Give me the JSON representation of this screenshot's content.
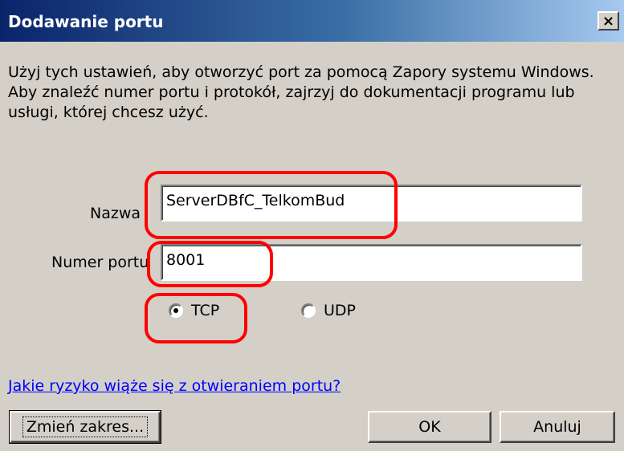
{
  "window": {
    "title": "Dodawanie portu",
    "close_label": "×"
  },
  "description": {
    "line1": "Użyj tych ustawień, aby otworzyć port za pomocą Zapory systemu Windows.",
    "line2": "Aby znaleźć numer portu i protokół, zajrzyj do dokumentacji programu lub",
    "line3": "usługi, której chcesz użyć."
  },
  "form": {
    "name_label": "Nazwa",
    "name_value": "ServerDBfC_TelkomBud",
    "port_label": "Numer portu",
    "port_value": "8001",
    "protocol_tcp_label": "TCP",
    "protocol_udp_label": "UDP",
    "protocol_selected": "TCP"
  },
  "link": {
    "risk_text": "Jakie ryzyko wiąże się z otwieraniem portu?"
  },
  "buttons": {
    "change_scope": "Zmień zakres...",
    "ok": "OK",
    "cancel": "Anuluj"
  },
  "colors": {
    "annotation": "#ff0000",
    "titlebar_start": "#0a246a",
    "titlebar_end": "#a6caf0",
    "link": "#0000ff"
  }
}
